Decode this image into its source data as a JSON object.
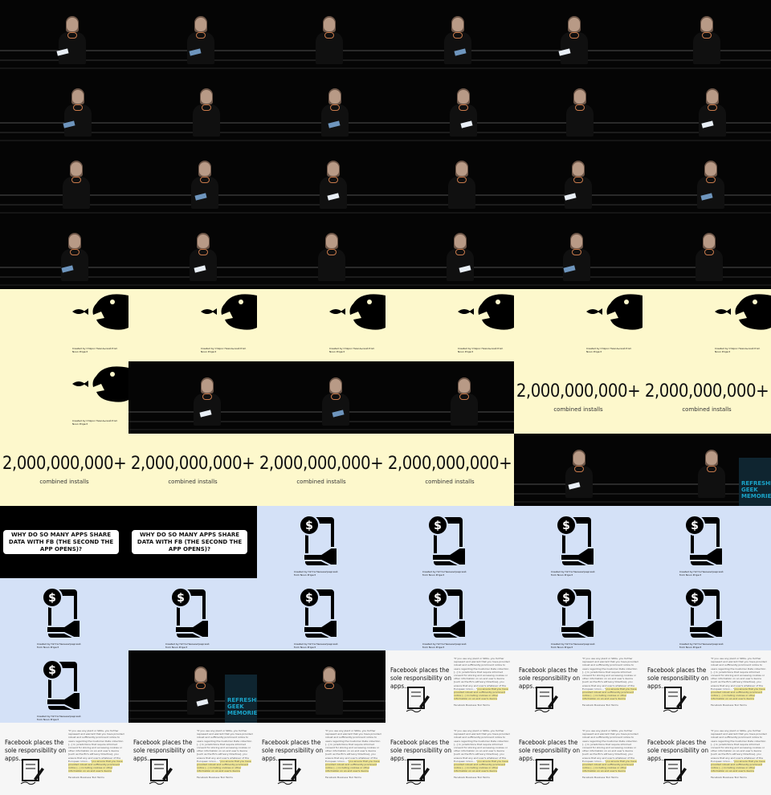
{
  "contact_sheet": {
    "stats_number": "2,000,000,000+",
    "stats_caption": "combined installs",
    "question_text": "WHY DO SO MANY APPS SHARE DATA WITH FB (THE SECOND THE APP OPENS)?",
    "fish_credit": "Created by Стёрос Никольский from Noun Project",
    "phone_credit": "Created by Гётта Немнинградский from Noun Project",
    "fb_title": "Facebook places the sole responsibility on apps...",
    "fb_quote": "\"If you use any plant or SDKs, you further represent and warrant that you have provided robust and sufficiently prominent notice to users regarding the Customer Data collection [...] In jurisdictions that require informed consent for storing and accessing cookies or other information on an end user's device [such as the EU's ePrivacy Directive], you ensure that any end user's whatever of the European Union... \"",
    "fb_quote_highlight": "you ensure that you have provided robust and sufficiently prominent notice (...) including cookies or other information on an end user's device",
    "fb_source": "Facebook Business Tool Terms",
    "podium_text": "REFRESHING GEEK MEMORIES",
    "colors": {
      "stage": "#050505",
      "cream": "#fdf8cc",
      "blue": "#d4e1f7",
      "white": "#f6f6f6"
    }
  }
}
